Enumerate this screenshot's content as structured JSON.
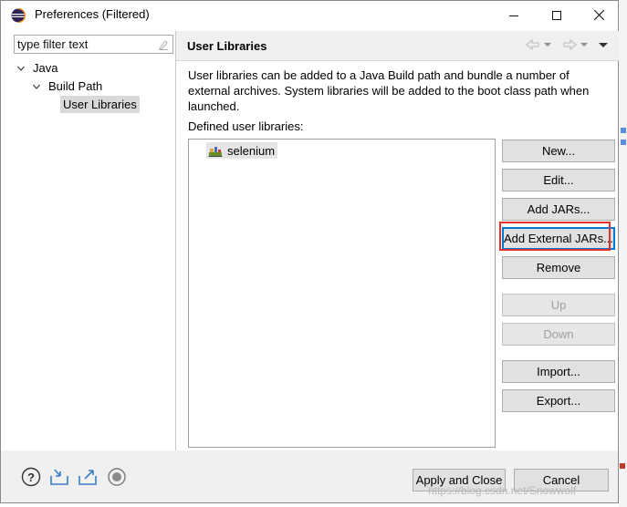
{
  "window": {
    "title": "Preferences (Filtered)",
    "minimize_icon": "minimize-icon",
    "maximize_icon": "maximize-icon",
    "close_icon": "close-icon"
  },
  "sidebar": {
    "filter_placeholder": "type filter text",
    "filter_value": "type filter text",
    "tree": [
      {
        "label": "Java",
        "expanded": true,
        "level": 0
      },
      {
        "label": "Build Path",
        "expanded": true,
        "level": 1
      },
      {
        "label": "User Libraries",
        "selected": true,
        "level": 2
      }
    ]
  },
  "page": {
    "title": "User Libraries",
    "description": "User libraries can be added to a Java Build path and bundle a number of external archives. System libraries will be added to the boot class path when launched.",
    "defined_label": "Defined user libraries:",
    "libraries": [
      {
        "name": "selenium",
        "icon": "library-icon"
      }
    ]
  },
  "buttons": {
    "new": "New...",
    "edit": "Edit...",
    "add_jars": "Add JARs...",
    "add_external_jars": "Add External JARs...",
    "remove": "Remove",
    "up": "Up",
    "down": "Down",
    "import": "Import...",
    "export": "Export..."
  },
  "footer": {
    "apply_close": "Apply and Close",
    "cancel": "Cancel",
    "watermark": "https://blog.csdn.net/Snowwolf"
  },
  "colors": {
    "highlight": "#e03030",
    "focus": "#0078d7",
    "eclipse_purple": "#2c2255"
  }
}
